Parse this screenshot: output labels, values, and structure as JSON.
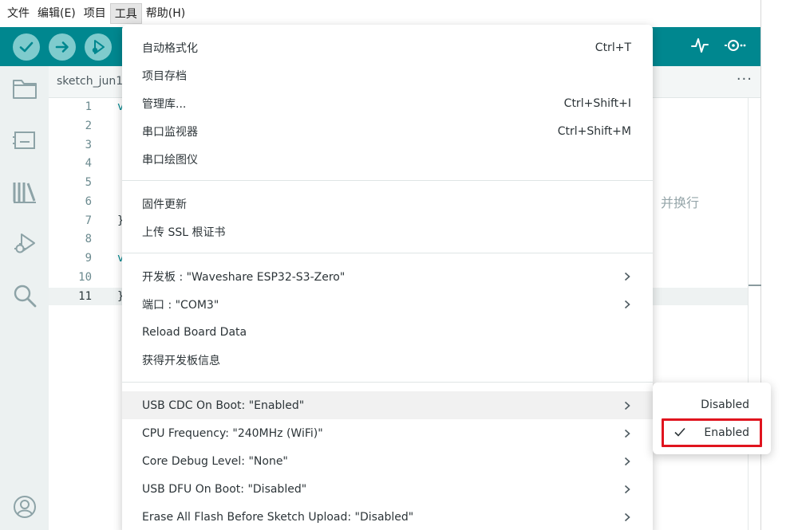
{
  "menubar": [
    "文件",
    "编辑(E)",
    "项目",
    "工具",
    "帮助(H)"
  ],
  "colors": {
    "toolbar": "#00878f",
    "button": "#7fcbcd",
    "highlight_box": "#e0141e"
  },
  "toolbar": {
    "left_icons": [
      "verify-icon",
      "upload-icon",
      "debug-icon"
    ],
    "right_icons": [
      "serial-plotter-icon",
      "serial-monitor-icon"
    ]
  },
  "sidebar": {
    "icons": [
      "folder-icon",
      "board-manager-icon",
      "library-icon",
      "debug-icon",
      "search-icon",
      "account-icon"
    ]
  },
  "editor": {
    "tab_name": "sketch_jun1",
    "more": "···",
    "line_numbers": [
      "1",
      "2",
      "3",
      "4",
      "5",
      "6",
      "7",
      "8",
      "9",
      "10",
      "11"
    ],
    "code_fragments": {
      "line1": "v",
      "line7": "}",
      "line9": "v",
      "line11": "}"
    },
    "hint_text": "并换行"
  },
  "tools_menu": {
    "groups": [
      [
        {
          "label": "自动格式化",
          "shortcut": "Ctrl+T"
        },
        {
          "label": "项目存档",
          "shortcut": ""
        },
        {
          "label": "管理库...",
          "shortcut": "Ctrl+Shift+I"
        },
        {
          "label": "串口监视器",
          "shortcut": "Ctrl+Shift+M"
        },
        {
          "label": "串口绘图仪",
          "shortcut": ""
        }
      ],
      [
        {
          "label": "固件更新",
          "shortcut": ""
        },
        {
          "label": "上传 SSL 根证书",
          "shortcut": ""
        }
      ],
      [
        {
          "label": "开发板 : \"Waveshare ESP32-S3-Zero\"",
          "submenu": true
        },
        {
          "label": "端口 : \"COM3\"",
          "submenu": true
        },
        {
          "label": "Reload Board Data",
          "submenu": false
        },
        {
          "label": "获得开发板信息",
          "submenu": false
        }
      ],
      [
        {
          "label": "USB CDC On Boot: \"Enabled\"",
          "submenu": true,
          "highlighted": true
        },
        {
          "label": "CPU Frequency: \"240MHz (WiFi)\"",
          "submenu": true
        },
        {
          "label": "Core Debug Level: \"None\"",
          "submenu": true
        },
        {
          "label": "USB DFU On Boot: \"Disabled\"",
          "submenu": true
        },
        {
          "label": "Erase All Flash Before Sketch Upload: \"Disabled\"",
          "submenu": true
        }
      ]
    ]
  },
  "submenu": {
    "options": [
      {
        "label": "Disabled",
        "checked": false
      },
      {
        "label": "Enabled",
        "checked": true
      }
    ]
  }
}
